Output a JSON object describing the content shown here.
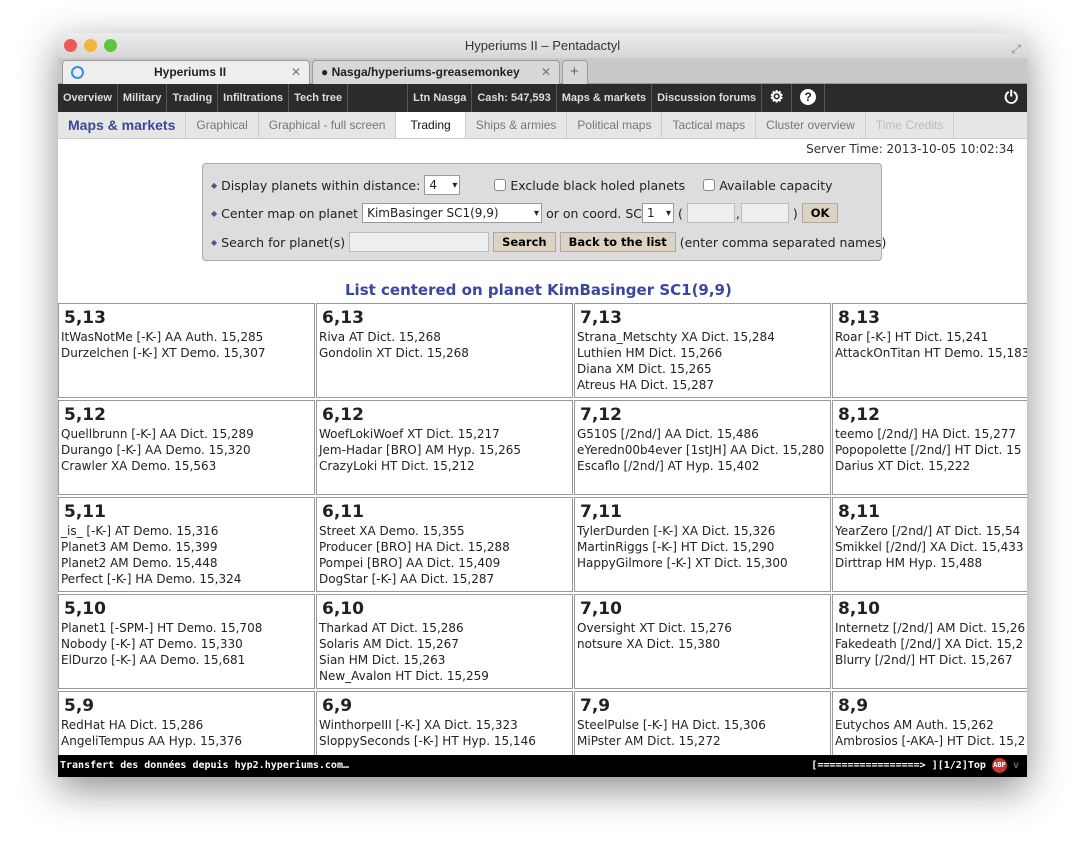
{
  "window": {
    "title": "Hyperiums II – Pentadactyl"
  },
  "tabs": [
    {
      "label": "Hyperiums II"
    },
    {
      "label": "Nasga/hyperiums-greasemonkey"
    }
  ],
  "new_tab": "+",
  "nav": {
    "items": [
      "Overview",
      "Military",
      "Trading",
      "Infiltrations",
      "Tech tree",
      "",
      "Ltn Nasga",
      "Cash: 547,593",
      "Maps & markets",
      "Discussion forums"
    ]
  },
  "subnav": {
    "title": "Maps & markets",
    "items": [
      "Graphical",
      "Graphical - full screen",
      "Trading",
      "Ships & armies",
      "Political maps",
      "Tactical maps",
      "Cluster overview",
      "Time Credits"
    ],
    "active": "Trading",
    "disabled": "Time Credits"
  },
  "server_time": "Server Time: 2013-10-05 10:02:34",
  "form": {
    "distance_label": "Display planets within distance:",
    "distance_value": "4",
    "exclude_bh": "Exclude black holed planets",
    "available_capacity": "Available capacity",
    "center_label": "Center map on planet",
    "center_value": "KimBasinger SC1(9,9)",
    "coord_label": "or on coord. SC",
    "sc_value": "1",
    "paren_open": "(",
    "comma": ",",
    "paren_close": ")",
    "ok": "OK",
    "search_label": "Search for planet(s)",
    "search_value": "",
    "search_button": "Search",
    "back_button": "Back to the list",
    "hint": "(enter comma separated names)"
  },
  "list_title": "List centered on planet KimBasinger SC1(9,9)",
  "grid": [
    [
      {
        "c": "5,13",
        "p": [
          "ItWasNotMe [-K-] AA Auth. 15,285",
          "Durzelchen [-K-] XT Demo. 15,307"
        ]
      },
      {
        "c": "6,13",
        "p": [
          "Riva AT Dict. 15,268",
          "Gondolin XT Dict. 15,268"
        ]
      },
      {
        "c": "7,13",
        "p": [
          "Strana_Metschty XA Dict. 15,284",
          "Luthien HM Dict. 15,266",
          "Diana XM Dict. 15,265",
          "Atreus HA Dict. 15,287"
        ]
      },
      {
        "c": "8,13",
        "p": [
          "Roar [-K-] HT Dict. 15,241",
          "AttackOnTitan HT Demo. 15,183"
        ]
      }
    ],
    [
      {
        "c": "5,12",
        "p": [
          "Quellbrunn [-K-] AA Dict. 15,289",
          "Durango [-K-] AA Demo. 15,320",
          "Crawler XA Demo. 15,563"
        ]
      },
      {
        "c": "6,12",
        "p": [
          "WoefLokiWoef XT Dict. 15,217",
          "Jem-Hadar [BRO] AM Hyp. 15,265",
          "CrazyLoki HT Dict. 15,212"
        ]
      },
      {
        "c": "7,12",
        "p": [
          "G510S [/2nd/] AA Dict. 15,486",
          "eYeredn00b4ever [1stJH] AA Dict. 15,280",
          "Escaflo [/2nd/] AT Hyp. 15,402"
        ]
      },
      {
        "c": "8,12",
        "p": [
          "teemo [/2nd/] HA Dict. 15,277",
          "Popopolette [/2nd/] HT Dict. 15",
          "Darius XT Dict. 15,222"
        ]
      }
    ],
    [
      {
        "c": "5,11",
        "p": [
          "_is_ [-K-] AT Demo. 15,316",
          "Planet3 AM Demo. 15,399",
          "Planet2 AM Demo. 15,448",
          "Perfect [-K-] HA Demo. 15,324"
        ]
      },
      {
        "c": "6,11",
        "p": [
          "Street XA Demo. 15,355",
          "Producer [BRO] HA Dict. 15,288",
          "Pompei [BRO] AA Dict. 15,409",
          "DogStar [-K-] AA Dict. 15,287"
        ]
      },
      {
        "c": "7,11",
        "p": [
          "TylerDurden [-K-] XA Dict. 15,326",
          "MartinRiggs [-K-] HT Dict. 15,290",
          "HappyGilmore [-K-] XT Dict. 15,300"
        ]
      },
      {
        "c": "8,11",
        "p": [
          "YearZero [/2nd/] AT Dict. 15,54",
          "Smikkel [/2nd/] XA Dict. 15,433",
          "Dirttrap HM Hyp. 15,488"
        ]
      }
    ],
    [
      {
        "c": "5,10",
        "p": [
          "Planet1 [-SPM-] HT Demo. 15,708",
          "Nobody [-K-] AT Demo. 15,330",
          "ElDurzo [-K-] AA Demo. 15,681"
        ]
      },
      {
        "c": "6,10",
        "p": [
          "Tharkad AT Dict. 15,286",
          "Solaris AM Dict. 15,267",
          "Sian HM Dict. 15,263",
          "New_Avalon HT Dict. 15,259"
        ]
      },
      {
        "c": "7,10",
        "p": [
          "Oversight XT Dict. 15,276",
          "notsure XA Dict. 15,380"
        ]
      },
      {
        "c": "8,10",
        "p": [
          "Internetz [/2nd/] AM Dict. 15,26",
          "Fakedeath [/2nd/] XA Dict. 15,2",
          "Blurry [/2nd/] HT Dict. 15,267"
        ]
      }
    ],
    [
      {
        "c": "5,9",
        "p": [
          "RedHat HA Dict. 15,286",
          "AngeliTempus AA Hyp. 15,376"
        ]
      },
      {
        "c": "6,9",
        "p": [
          "WinthorpeIII [-K-] XA Dict. 15,323",
          "SloppySeconds [-K-] HT Hyp. 15,146"
        ]
      },
      {
        "c": "7,9",
        "p": [
          "SteelPulse [-K-] HA Dict. 15,306",
          "MiPster AM Dict. 15,272"
        ]
      },
      {
        "c": "8,9",
        "p": [
          "Eutychos AM Auth. 15,262",
          "Ambrosios [-AKA-] HT Dict. 15,2"
        ]
      }
    ]
  ],
  "statusbar": {
    "message": "Transfert des données depuis hyp2.hyperiums.com…",
    "progress": "[=================> ]",
    "position": "[1/2]Top",
    "adblock": "ABP"
  },
  "colors": {
    "accent": "#3a47a0",
    "nav_bg": "#2b2b2b"
  }
}
